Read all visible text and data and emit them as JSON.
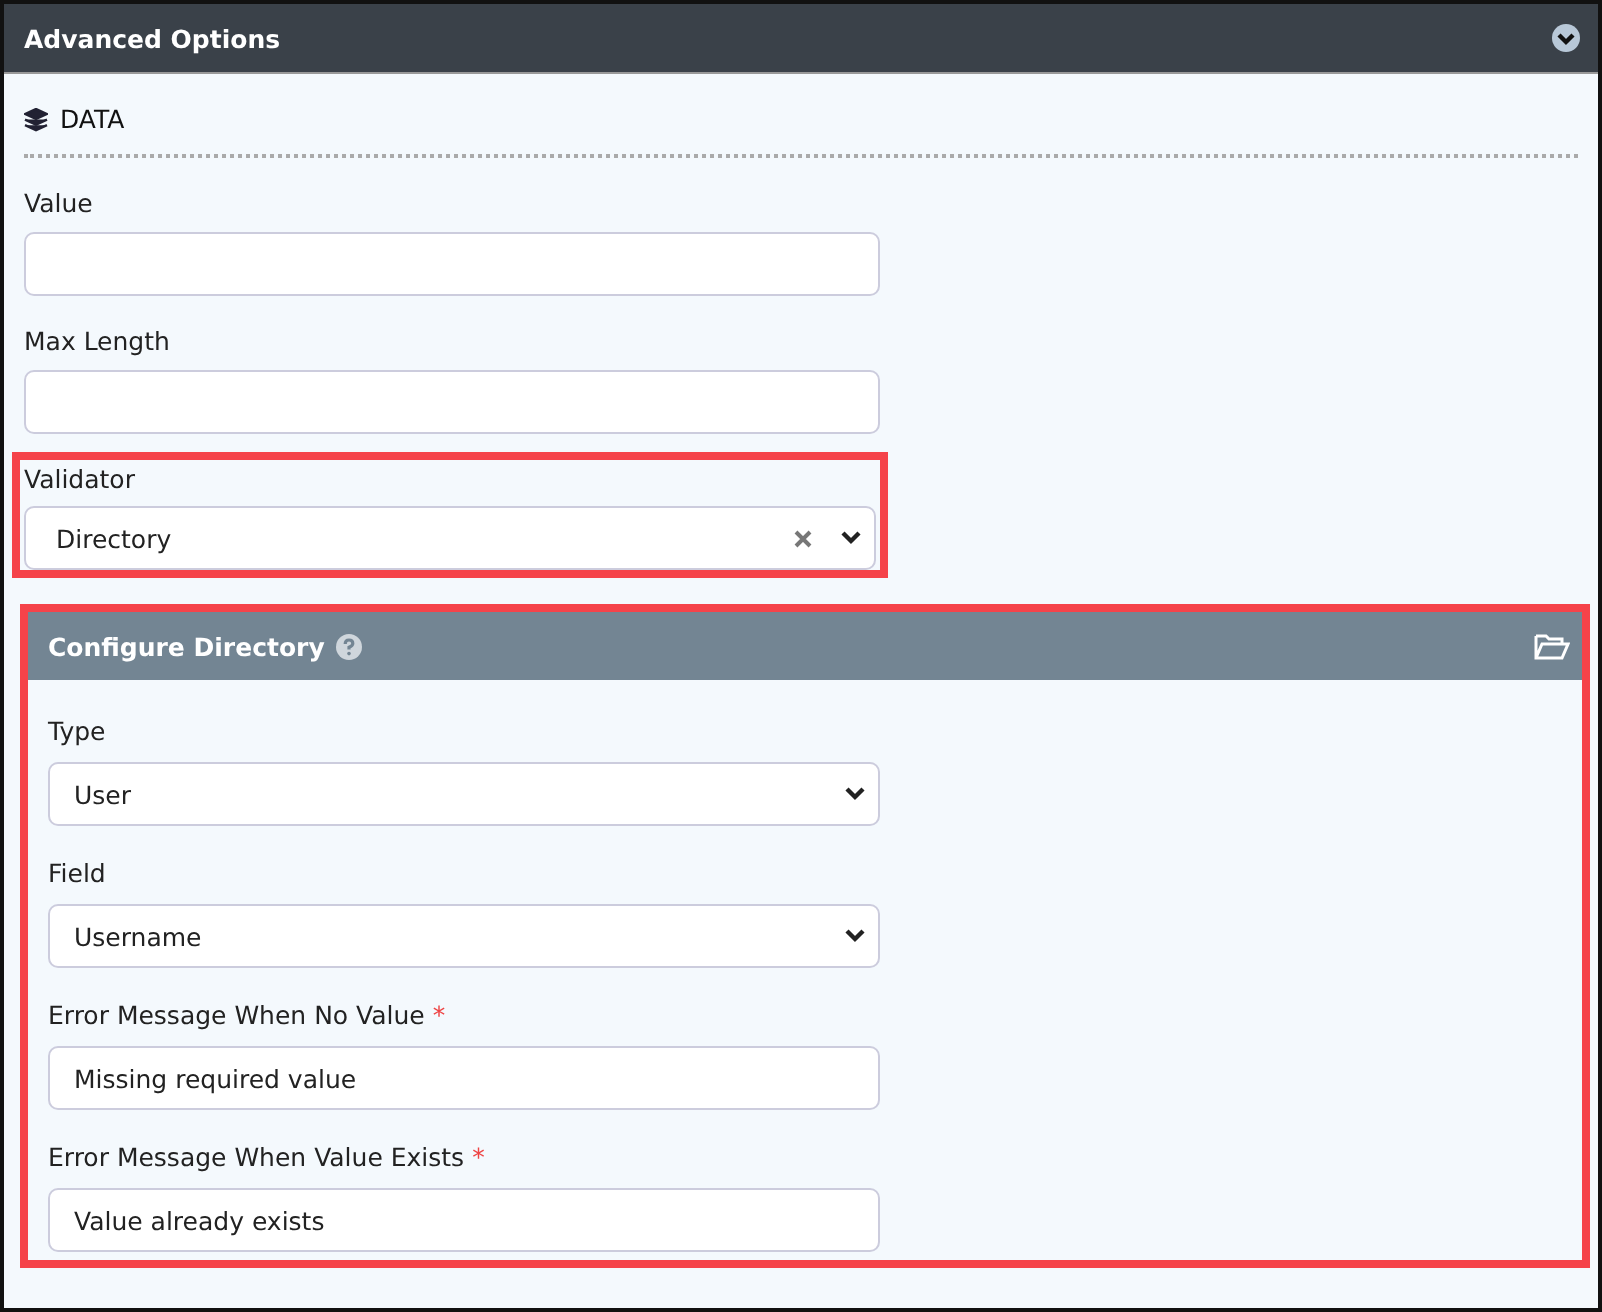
{
  "panel": {
    "title": "Advanced Options",
    "expanded": true
  },
  "section": {
    "title": "DATA"
  },
  "fields": [
    {
      "label": "Value",
      "kind": "text",
      "highlighted": false
    },
    {
      "label": "Max Length",
      "kind": "text",
      "highlighted": false
    },
    {
      "label": "Validator",
      "kind": "clearable-select",
      "value": "Directory",
      "highlighted": true
    }
  ],
  "subpanel": {
    "title": "Configure Directory",
    "highlighted": true,
    "fields": [
      {
        "label": "Type",
        "kind": "select",
        "value": "User"
      },
      {
        "label": "Field",
        "kind": "select",
        "value": "Username"
      },
      {
        "label": "Error Message When No Value",
        "kind": "text",
        "value": "Missing required value",
        "required_mark": "*"
      },
      {
        "label": "Error Message When Value Exists",
        "kind": "text",
        "value": "Value already exists",
        "required_mark": "*"
      }
    ]
  }
}
